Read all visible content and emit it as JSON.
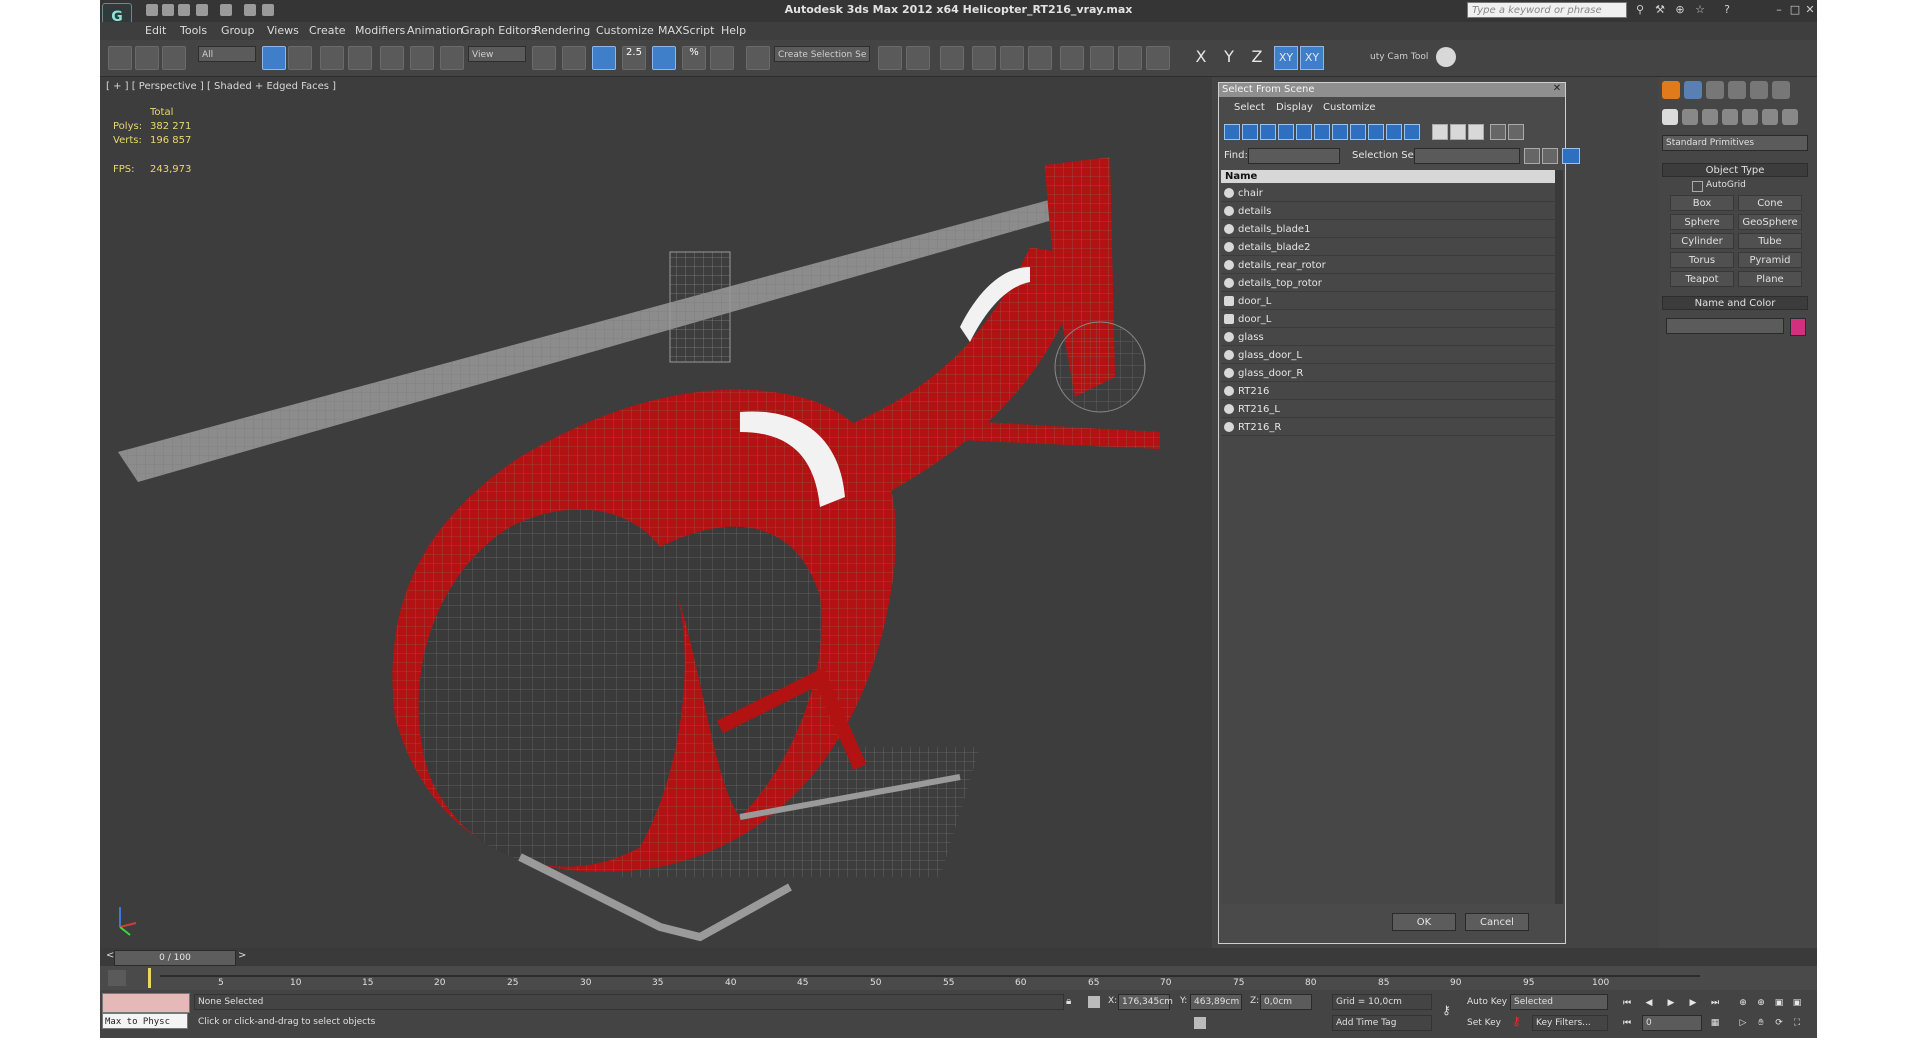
{
  "titlebar": {
    "title": "Autodesk 3ds Max  2012 x64      Helicopter_RT216_vray.max",
    "logo": "3dsmax-logo-icon",
    "search_placeholder": "Type a keyword or phrase"
  },
  "menubar": {
    "items": [
      "Edit",
      "Tools",
      "Group",
      "Views",
      "Create",
      "Modifiers",
      "Animation",
      "Graph Editors",
      "Rendering",
      "Customize",
      "MAXScript",
      "Help"
    ]
  },
  "toolbar": {
    "filter": "All",
    "ref_coord": "View",
    "snap_25": "2.5",
    "snap_pct": "%",
    "named_selection": "Create Selection Se",
    "axes": [
      "X",
      "Y",
      "Z",
      "XY",
      "XY"
    ],
    "cam_tool": "uty Cam Tool"
  },
  "viewport": {
    "label": "[ + ] [ Perspective ] [ Shaded + Edged Faces ]",
    "stats": {
      "header": "Total",
      "polys_label": "Polys:",
      "polys_value": "382 271",
      "verts_label": "Verts:",
      "verts_value": "196 857",
      "fps_label": "FPS:",
      "fps_value": "243,973"
    },
    "body_color": "#b31212",
    "wire_color": "#8a8a8a"
  },
  "dialog": {
    "title": "Select From Scene",
    "menu": [
      "Select",
      "Display",
      "Customize"
    ],
    "find_label": "Find:",
    "selection_set_label": "Selection Set:",
    "list_header": "Name",
    "objects": [
      "chair",
      "details",
      "details_blade1",
      "details_blade2",
      "details_rear_rotor",
      "details_top_rotor",
      "door_L",
      "door_L",
      "glass",
      "glass_door_L",
      "glass_door_R",
      "RT216",
      "RT216_L",
      "RT216_R"
    ],
    "ok": "OK",
    "cancel": "Cancel"
  },
  "command_panel": {
    "category": "Standard Primitives",
    "object_type_title": "Object Type",
    "autogrid": "AutoGrid",
    "primitives": [
      "Box",
      "Cone",
      "Sphere",
      "GeoSphere",
      "Cylinder",
      "Tube",
      "Torus",
      "Pyramid",
      "Teapot",
      "Plane"
    ],
    "name_color_title": "Name and Color",
    "swatch_color": "#d2307e"
  },
  "timeline": {
    "frame_counter": "0 / 100",
    "ticks": [
      "5",
      "10",
      "15",
      "20",
      "25",
      "30",
      "35",
      "40",
      "45",
      "50",
      "55",
      "60",
      "65",
      "70",
      "75",
      "80",
      "85",
      "90",
      "95",
      "100"
    ]
  },
  "status": {
    "maxscript": "Max to Physc",
    "selection": "None Selected",
    "prompt": "Click or click-and-drag to select objects",
    "x_label": "X:",
    "x_value": "176,345cm",
    "y_label": "Y:",
    "y_value": "463,89cm",
    "z_label": "Z:",
    "z_value": "0,0cm",
    "grid": "Grid = 10,0cm",
    "add_time_tag": "Add Time Tag",
    "auto_key": "Auto Key",
    "set_key": "Set Key",
    "key_mode": "Selected",
    "key_filters": "Key Filters...",
    "current_frame": "0"
  }
}
